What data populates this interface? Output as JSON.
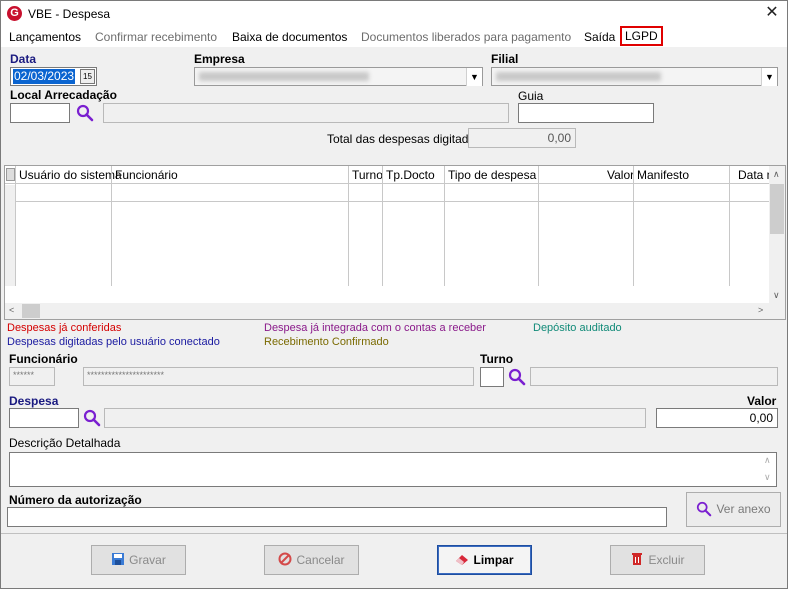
{
  "window": {
    "title": "VBE - Despesa",
    "icon": "app-logo-icon",
    "close_icon": "close-icon"
  },
  "menu": {
    "lancamentos": "Lançamentos",
    "confirmar_recebimento": "Confirmar recebimento",
    "baixa_documentos": "Baixa de documentos",
    "documentos_liberados": "Documentos liberados para pagamento",
    "saida": "Saída",
    "lgpd": "LGPD"
  },
  "form": {
    "data_label": "Data",
    "data_value": "02/03/2023",
    "empresa_label": "Empresa",
    "filial_label": "Filial",
    "local_label": "Local Arrecadação",
    "guia_label": "Guia",
    "total_label": "Total das despesas digitadas",
    "total_value": "0,00"
  },
  "grid": {
    "columns": [
      "Usuário do sistema",
      "Funcionário",
      "Turno",
      "Tp.Docto",
      "Tipo de despesa",
      "Valor",
      "Manifesto",
      "Data m"
    ]
  },
  "legend": {
    "conferidas": "Despesas já conferidas",
    "integrada": "Despesa já integrada com o contas a receber",
    "deposito": "Depósito auditado",
    "digitadas": "Despesas digitadas pelo usuário conectado",
    "recebimento": "Recebimento Confirmado",
    "colors": {
      "conferidas": "#d40000",
      "integrada": "#8a1a8a",
      "deposito": "#118a78",
      "digitadas": "#1a1aa0",
      "recebimento": "#7a6a00"
    }
  },
  "detail": {
    "funcionario_label": "Funcionário",
    "funcionario_code": "******",
    "funcionario_name": "**********************",
    "turno_label": "Turno",
    "despesa_label": "Despesa",
    "valor_label": "Valor",
    "valor_value": "0,00",
    "descricao_label": "Descrição Detalhada",
    "autorizacao_label": "Número da autorização",
    "ver_anexo": "Ver anexo"
  },
  "buttons": {
    "gravar": "Gravar",
    "cancelar": "Cancelar",
    "limpar": "Limpar",
    "excluir": "Excluir"
  }
}
